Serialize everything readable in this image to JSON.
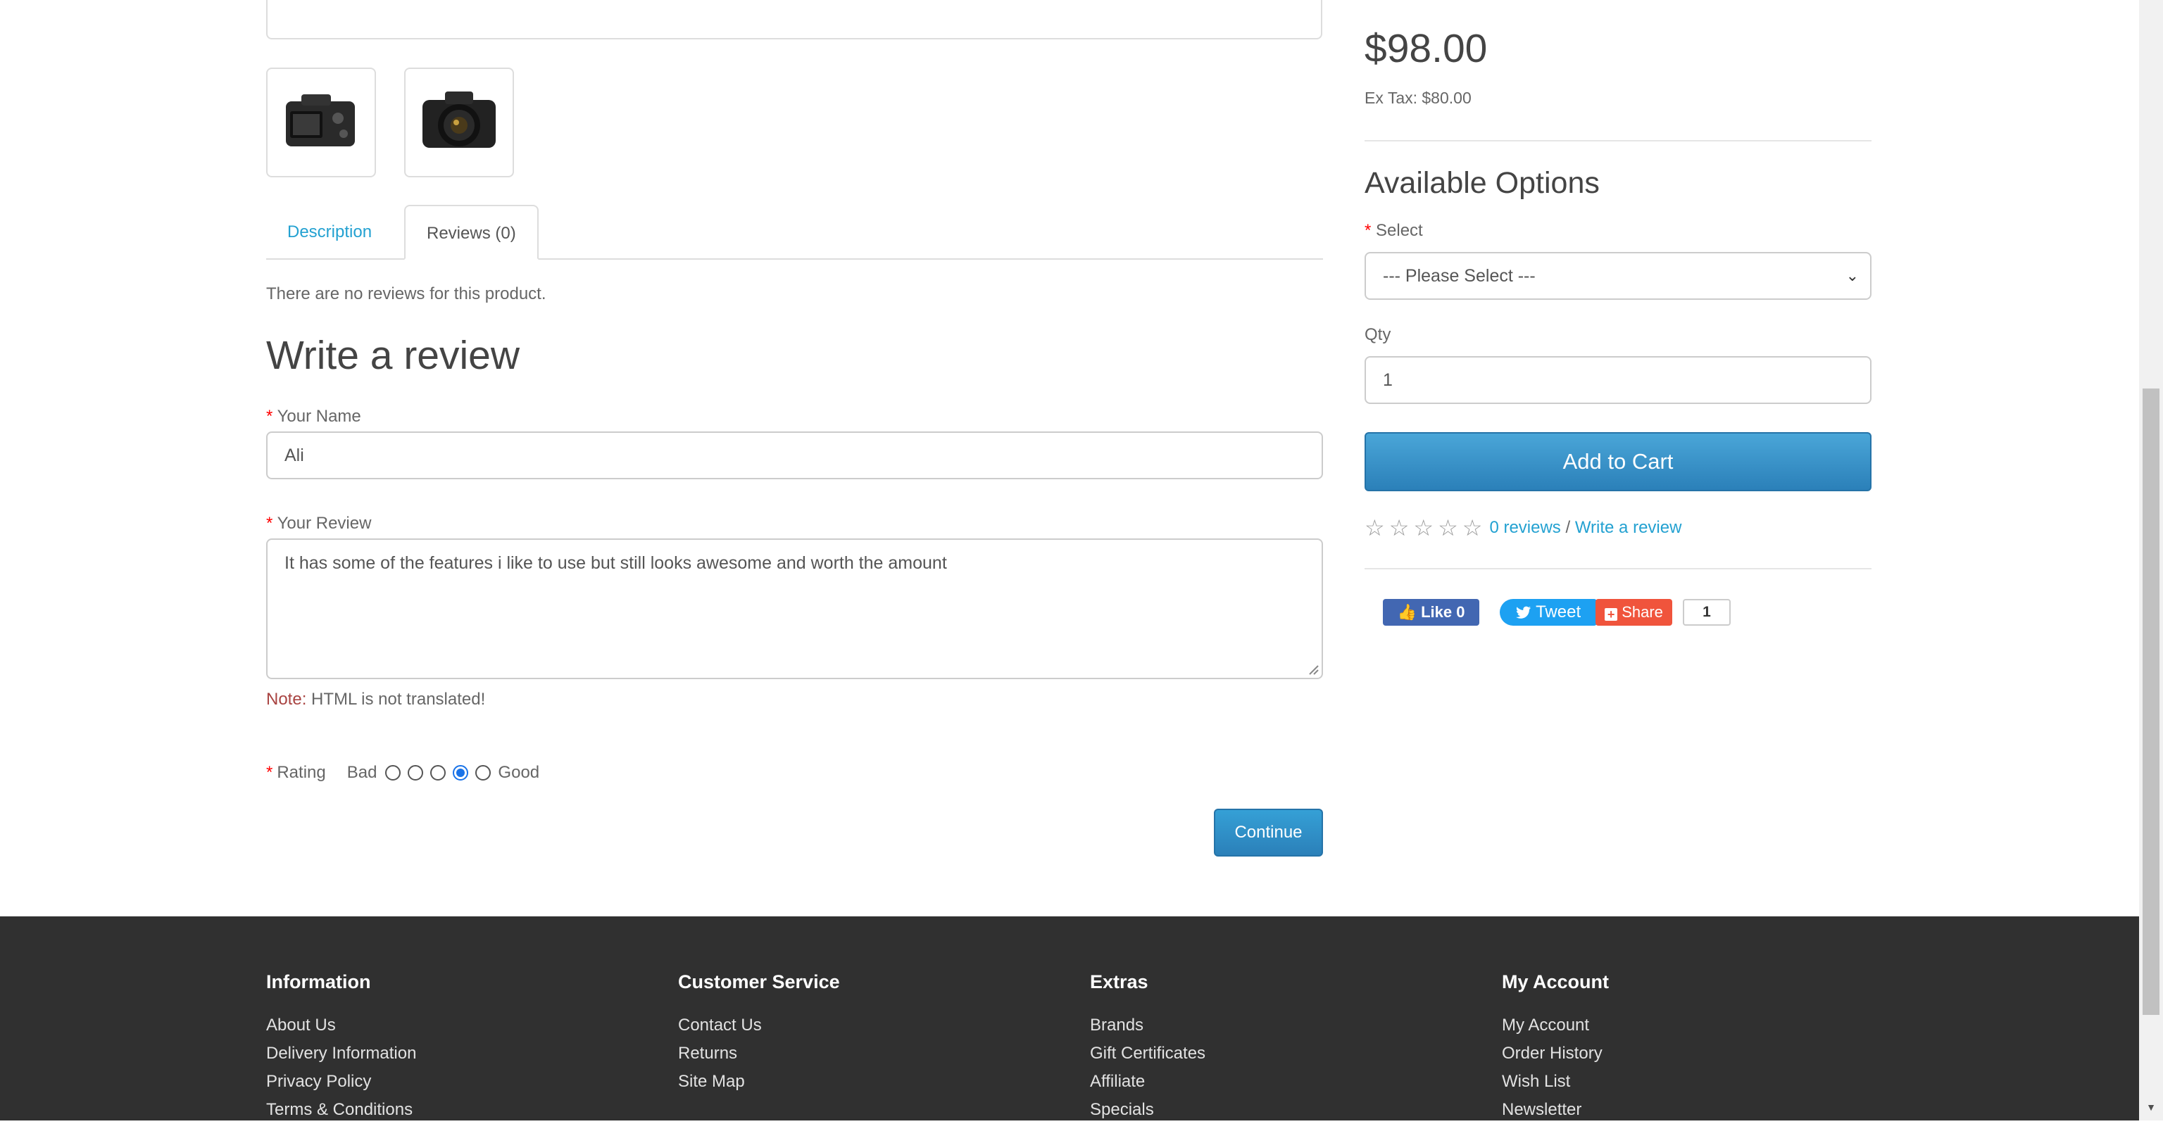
{
  "product": {
    "price": "$98.00",
    "ex_tax": "Ex Tax: $80.00"
  },
  "thumbnails": [
    {
      "icon": "camera-back-thumbnail"
    },
    {
      "icon": "camera-front-thumbnail"
    }
  ],
  "tabs": [
    {
      "label": "Description"
    },
    {
      "label": "Reviews (0)"
    }
  ],
  "reviews": {
    "empty_text": "There are no reviews for this product.",
    "write_title": "Write a review",
    "name_label": "Your Name",
    "name_value": "Ali",
    "review_label": "Your Review",
    "review_value": "It has some of the features i like to use but still looks awesome and worth the amount",
    "note_label": "Note:",
    "note_text": " HTML is not translated!",
    "rating_label": "Rating",
    "rating_bad": "Bad",
    "rating_good": "Good",
    "rating_selected": 4,
    "continue_label": "Continue",
    "required_mark": "*"
  },
  "options": {
    "title": "Available Options",
    "select_label": "Select",
    "select_value": "--- Please Select ---",
    "qty_label": "Qty",
    "qty_value": "1",
    "add_to_cart": "Add to Cart",
    "reviews_link": "0 reviews",
    "separator": " / ",
    "write_review_link": "Write a review"
  },
  "social": {
    "like_label": "Like 0",
    "tweet_label": "Tweet",
    "share_label": "Share",
    "share_count": "1"
  },
  "footer": {
    "columns": [
      {
        "title": "Information",
        "links": [
          "About Us",
          "Delivery Information",
          "Privacy Policy",
          "Terms & Conditions"
        ]
      },
      {
        "title": "Customer Service",
        "links": [
          "Contact Us",
          "Returns",
          "Site Map"
        ]
      },
      {
        "title": "Extras",
        "links": [
          "Brands",
          "Gift Certificates",
          "Affiliate",
          "Specials"
        ]
      },
      {
        "title": "My Account",
        "links": [
          "My Account",
          "Order History",
          "Wish List",
          "Newsletter"
        ]
      }
    ]
  },
  "colors": {
    "link": "#23a1d1",
    "button": "#2b80b9",
    "footer_bg": "#303030",
    "radio_checked": "#1a73e8"
  }
}
